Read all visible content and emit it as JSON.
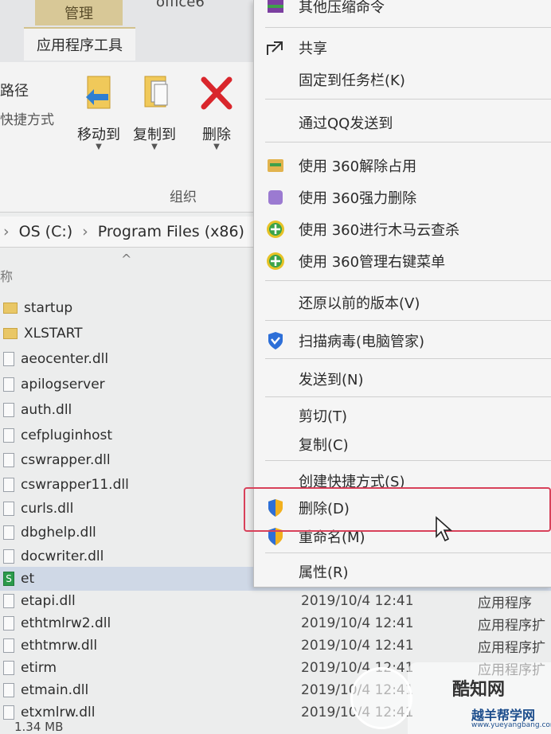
{
  "ribbon": {
    "tab_manage": "管理",
    "tab_office": "office6",
    "tab_apptools": "应用程序工具",
    "left_label_1": "路径",
    "left_label_2": "快捷方式",
    "move_to": "移动到",
    "copy_to": "复制到",
    "delete": "删除",
    "group_label": "组织"
  },
  "address": {
    "drive": "OS (C:)",
    "sep": "›",
    "folder": "Program Files (x86)"
  },
  "column_hint": "称",
  "files": [
    {
      "name": "startup",
      "icon": "folder-icon",
      "date": "",
      "type": ""
    },
    {
      "name": "XLSTART",
      "icon": "folder-icon",
      "date": "",
      "type": ""
    },
    {
      "name": "aeocenter.dll",
      "icon": "dll-file-icon",
      "date": "",
      "type": ""
    },
    {
      "name": "apilogserver",
      "icon": "exe-file-icon",
      "date": "",
      "type": ""
    },
    {
      "name": "auth.dll",
      "icon": "dll-file-icon",
      "date": "",
      "type": ""
    },
    {
      "name": "cefpluginhost",
      "icon": "exe-file-icon",
      "date": "",
      "type": ""
    },
    {
      "name": "cswrapper.dll",
      "icon": "dll-file-icon",
      "date": "",
      "type": ""
    },
    {
      "name": "cswrapper11.dll",
      "icon": "dll-file-icon",
      "date": "",
      "type": ""
    },
    {
      "name": "curls.dll",
      "icon": "dll-file-icon",
      "date": "",
      "type": ""
    },
    {
      "name": "dbghelp.dll",
      "icon": "dll-file-icon",
      "date": "",
      "type": ""
    },
    {
      "name": "docwriter.dll",
      "icon": "dll-file-icon",
      "date": "",
      "type": ""
    },
    {
      "name": "et",
      "icon": "exe-file-icon",
      "date": "",
      "type": ""
    },
    {
      "name": "etapi.dll",
      "icon": "dll-file-icon",
      "date": "2019/10/4 12:41",
      "type": "应用程序"
    },
    {
      "name": "ethtmlrw2.dll",
      "icon": "dll-file-icon",
      "date": "2019/10/4 12:41",
      "type": "应用程序扩"
    },
    {
      "name": "ethtmrw.dll",
      "icon": "dll-file-icon",
      "date": "2019/10/4 12:41",
      "type": "应用程序扩"
    },
    {
      "name": "etirm",
      "icon": "file-icon",
      "date": "2019/10/4 12:41",
      "type": "应用程序扩"
    },
    {
      "name": "etmain.dll",
      "icon": "dll-file-icon",
      "date": "2019/10/4 12:41",
      "type": ""
    },
    {
      "name": "etxmlrw.dll",
      "icon": "dll-file-icon",
      "date": "2019/10/4 12:41",
      "type": ""
    }
  ],
  "status": "1.34 MB",
  "context_menu": {
    "items": [
      {
        "label": "其他压缩命令",
        "icon": "archive-icon"
      },
      {
        "label": "共享",
        "icon": "share-icon"
      },
      {
        "label": "固定到任务栏(K)",
        "icon": ""
      },
      {
        "label": "通过QQ发送到",
        "icon": ""
      },
      {
        "label": "使用 360解除占用",
        "icon": "360-unlock-icon"
      },
      {
        "label": "使用 360强力删除",
        "icon": "360-shred-icon"
      },
      {
        "label": "使用 360进行木马云查杀",
        "icon": "360-scan-icon"
      },
      {
        "label": "使用 360管理右键菜单",
        "icon": "360-menu-icon"
      },
      {
        "label": "还原以前的版本(V)",
        "icon": ""
      },
      {
        "label": "扫描病毒(电脑管家)",
        "icon": "shield-icon"
      },
      {
        "label": "发送到(N)",
        "icon": ""
      },
      {
        "label": "剪切(T)",
        "icon": ""
      },
      {
        "label": "复制(C)",
        "icon": ""
      },
      {
        "label": "创建快捷方式(S)",
        "icon": ""
      },
      {
        "label": "删除(D)",
        "icon": "uac-shield-icon"
      },
      {
        "label": "重命名(M)",
        "icon": "uac-shield-icon"
      },
      {
        "label": "属性(R)",
        "icon": ""
      }
    ]
  },
  "watermark": {
    "title": "酷知网",
    "sub": "越羊帮学网",
    "url": "www.yueyangbang.com"
  },
  "colors": {
    "highlight": "#d8415a",
    "manage_tab": "#d8c897",
    "delete_red": "#d9262c"
  }
}
